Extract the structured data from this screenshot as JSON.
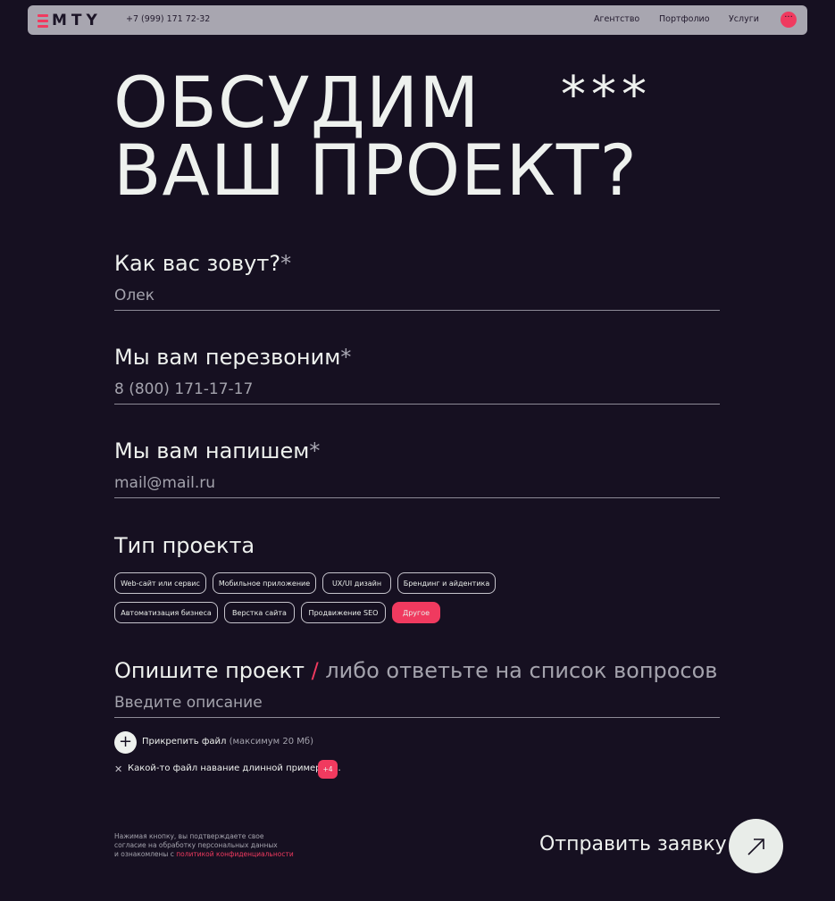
{
  "header": {
    "logo": "MTY",
    "phone": "+7 (999) 171 72-32",
    "nav": [
      "Агентство",
      "Портфолио",
      "Услуги"
    ],
    "menu_icon": "···"
  },
  "hero": {
    "title_line1": "ОБСУДИМ",
    "title_line2": "ВАШ ПРОЕКТ?",
    "decoration": "***"
  },
  "form": {
    "name": {
      "label": "Как вас зовут?",
      "required_mark": "*",
      "placeholder": "Олек"
    },
    "phone": {
      "label": "Мы вам перезвоним",
      "required_mark": "*",
      "placeholder": "8 (800) 171-17-17"
    },
    "email": {
      "label": "Мы вам напишем",
      "required_mark": "*",
      "placeholder": "mail@mail.ru"
    },
    "project_type": {
      "label": "Тип проекта",
      "options": [
        "Web-сайт или сервис",
        "Мобильное приложение",
        "UX/UI дизайн",
        "Брендинг и айдентика",
        "Автоматизация бизнеса",
        "Верстка сайта",
        "Продвижение SEO",
        "Другое"
      ],
      "selected": "Другое"
    },
    "description": {
      "label": "Опишите проект",
      "separator": "/",
      "label_alt": "либо ответьте на список вопросов",
      "placeholder": "Введите описание"
    },
    "attach": {
      "label": "Прикрепить файл",
      "hint": "(максимум 20 Мб)",
      "file_name": "Какой-то файл навание длинной примерно...",
      "extra_count": "+4"
    },
    "consent": {
      "line1": "Нажимая кнопку, вы подтверждаете свое",
      "line2": "согласие на обработку персональных данных",
      "line3": "и ознакомлены с",
      "link": "политикой конфиденциальности"
    },
    "submit": "Отправить заявку"
  },
  "colors": {
    "accent": "#f03a5f",
    "background": "#161021",
    "header_bg": "#a8a6b0"
  }
}
